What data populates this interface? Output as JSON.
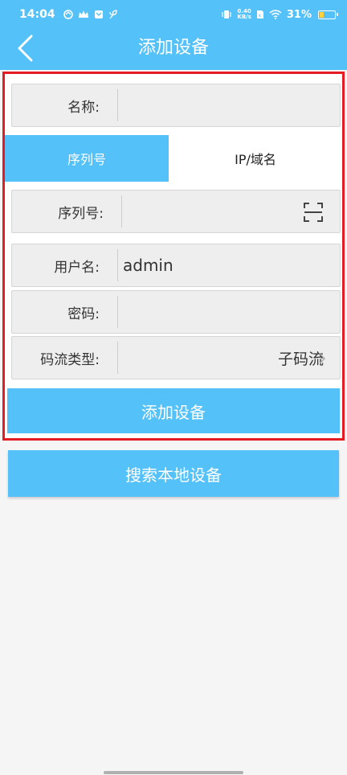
{
  "status_bar": {
    "time": "14:04",
    "speed_value": "0.40",
    "speed_unit": "KB/s",
    "battery_percent": "31%",
    "battery_level": 0.31
  },
  "header": {
    "title": "添加设备",
    "back_icon": "chevron-left-icon"
  },
  "form": {
    "name_label": "名称:",
    "name_value": "",
    "tabs": [
      {
        "label": "序列号",
        "active": true
      },
      {
        "label": "IP/域名",
        "active": false
      }
    ],
    "serial_label": "序列号:",
    "serial_value": "",
    "username_label": "用户名:",
    "username_value": "admin",
    "password_label": "密码:",
    "password_value": "",
    "stream_label": "码流类型:",
    "stream_value": "子码流",
    "add_button": "添加设备"
  },
  "search_button": "搜索本地设备",
  "colors": {
    "accent": "#55c1f9",
    "highlight_border": "#e41c24"
  }
}
